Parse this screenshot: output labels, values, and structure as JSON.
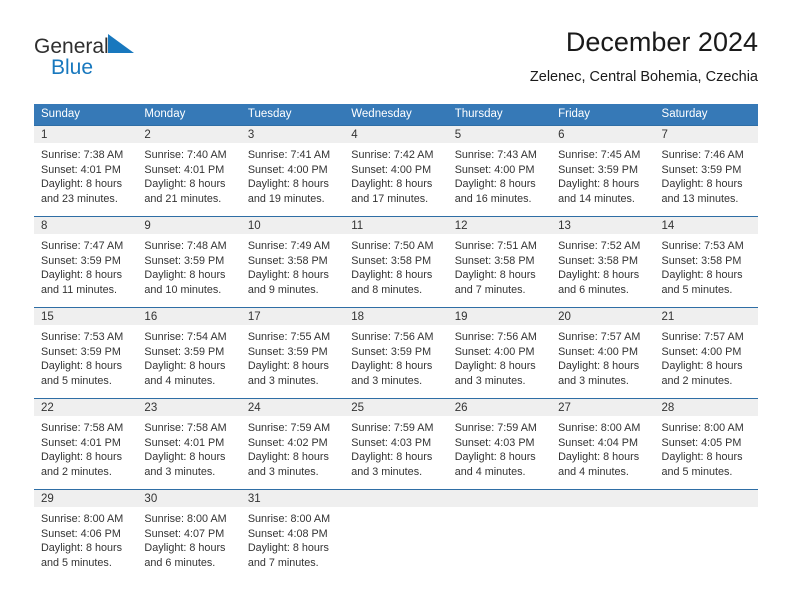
{
  "brand": {
    "name_part1": "General",
    "name_part2": "Blue",
    "color_dark": "#2f2f2f",
    "color_blue": "#1878be"
  },
  "header": {
    "title": "December 2024",
    "subtitle": "Zelenec, Central Bohemia, Czechia"
  },
  "theme": {
    "header_row_bg": "#3679b7",
    "row_divider": "#2f6ea5",
    "daynum_bg": "#efefef",
    "text": "#333333"
  },
  "calendar": {
    "weekday_headers": [
      "Sunday",
      "Monday",
      "Tuesday",
      "Wednesday",
      "Thursday",
      "Friday",
      "Saturday"
    ],
    "weeks": [
      [
        {
          "day": "1",
          "sunrise": "Sunrise: 7:38 AM",
          "sunset": "Sunset: 4:01 PM",
          "daylight_line1": "Daylight: 8 hours",
          "daylight_line2": "and 23 minutes."
        },
        {
          "day": "2",
          "sunrise": "Sunrise: 7:40 AM",
          "sunset": "Sunset: 4:01 PM",
          "daylight_line1": "Daylight: 8 hours",
          "daylight_line2": "and 21 minutes."
        },
        {
          "day": "3",
          "sunrise": "Sunrise: 7:41 AM",
          "sunset": "Sunset: 4:00 PM",
          "daylight_line1": "Daylight: 8 hours",
          "daylight_line2": "and 19 minutes."
        },
        {
          "day": "4",
          "sunrise": "Sunrise: 7:42 AM",
          "sunset": "Sunset: 4:00 PM",
          "daylight_line1": "Daylight: 8 hours",
          "daylight_line2": "and 17 minutes."
        },
        {
          "day": "5",
          "sunrise": "Sunrise: 7:43 AM",
          "sunset": "Sunset: 4:00 PM",
          "daylight_line1": "Daylight: 8 hours",
          "daylight_line2": "and 16 minutes."
        },
        {
          "day": "6",
          "sunrise": "Sunrise: 7:45 AM",
          "sunset": "Sunset: 3:59 PM",
          "daylight_line1": "Daylight: 8 hours",
          "daylight_line2": "and 14 minutes."
        },
        {
          "day": "7",
          "sunrise": "Sunrise: 7:46 AM",
          "sunset": "Sunset: 3:59 PM",
          "daylight_line1": "Daylight: 8 hours",
          "daylight_line2": "and 13 minutes."
        }
      ],
      [
        {
          "day": "8",
          "sunrise": "Sunrise: 7:47 AM",
          "sunset": "Sunset: 3:59 PM",
          "daylight_line1": "Daylight: 8 hours",
          "daylight_line2": "and 11 minutes."
        },
        {
          "day": "9",
          "sunrise": "Sunrise: 7:48 AM",
          "sunset": "Sunset: 3:59 PM",
          "daylight_line1": "Daylight: 8 hours",
          "daylight_line2": "and 10 minutes."
        },
        {
          "day": "10",
          "sunrise": "Sunrise: 7:49 AM",
          "sunset": "Sunset: 3:58 PM",
          "daylight_line1": "Daylight: 8 hours",
          "daylight_line2": "and 9 minutes."
        },
        {
          "day": "11",
          "sunrise": "Sunrise: 7:50 AM",
          "sunset": "Sunset: 3:58 PM",
          "daylight_line1": "Daylight: 8 hours",
          "daylight_line2": "and 8 minutes."
        },
        {
          "day": "12",
          "sunrise": "Sunrise: 7:51 AM",
          "sunset": "Sunset: 3:58 PM",
          "daylight_line1": "Daylight: 8 hours",
          "daylight_line2": "and 7 minutes."
        },
        {
          "day": "13",
          "sunrise": "Sunrise: 7:52 AM",
          "sunset": "Sunset: 3:58 PM",
          "daylight_line1": "Daylight: 8 hours",
          "daylight_line2": "and 6 minutes."
        },
        {
          "day": "14",
          "sunrise": "Sunrise: 7:53 AM",
          "sunset": "Sunset: 3:58 PM",
          "daylight_line1": "Daylight: 8 hours",
          "daylight_line2": "and 5 minutes."
        }
      ],
      [
        {
          "day": "15",
          "sunrise": "Sunrise: 7:53 AM",
          "sunset": "Sunset: 3:59 PM",
          "daylight_line1": "Daylight: 8 hours",
          "daylight_line2": "and 5 minutes."
        },
        {
          "day": "16",
          "sunrise": "Sunrise: 7:54 AM",
          "sunset": "Sunset: 3:59 PM",
          "daylight_line1": "Daylight: 8 hours",
          "daylight_line2": "and 4 minutes."
        },
        {
          "day": "17",
          "sunrise": "Sunrise: 7:55 AM",
          "sunset": "Sunset: 3:59 PM",
          "daylight_line1": "Daylight: 8 hours",
          "daylight_line2": "and 3 minutes."
        },
        {
          "day": "18",
          "sunrise": "Sunrise: 7:56 AM",
          "sunset": "Sunset: 3:59 PM",
          "daylight_line1": "Daylight: 8 hours",
          "daylight_line2": "and 3 minutes."
        },
        {
          "day": "19",
          "sunrise": "Sunrise: 7:56 AM",
          "sunset": "Sunset: 4:00 PM",
          "daylight_line1": "Daylight: 8 hours",
          "daylight_line2": "and 3 minutes."
        },
        {
          "day": "20",
          "sunrise": "Sunrise: 7:57 AM",
          "sunset": "Sunset: 4:00 PM",
          "daylight_line1": "Daylight: 8 hours",
          "daylight_line2": "and 3 minutes."
        },
        {
          "day": "21",
          "sunrise": "Sunrise: 7:57 AM",
          "sunset": "Sunset: 4:00 PM",
          "daylight_line1": "Daylight: 8 hours",
          "daylight_line2": "and 2 minutes."
        }
      ],
      [
        {
          "day": "22",
          "sunrise": "Sunrise: 7:58 AM",
          "sunset": "Sunset: 4:01 PM",
          "daylight_line1": "Daylight: 8 hours",
          "daylight_line2": "and 2 minutes."
        },
        {
          "day": "23",
          "sunrise": "Sunrise: 7:58 AM",
          "sunset": "Sunset: 4:01 PM",
          "daylight_line1": "Daylight: 8 hours",
          "daylight_line2": "and 3 minutes."
        },
        {
          "day": "24",
          "sunrise": "Sunrise: 7:59 AM",
          "sunset": "Sunset: 4:02 PM",
          "daylight_line1": "Daylight: 8 hours",
          "daylight_line2": "and 3 minutes."
        },
        {
          "day": "25",
          "sunrise": "Sunrise: 7:59 AM",
          "sunset": "Sunset: 4:03 PM",
          "daylight_line1": "Daylight: 8 hours",
          "daylight_line2": "and 3 minutes."
        },
        {
          "day": "26",
          "sunrise": "Sunrise: 7:59 AM",
          "sunset": "Sunset: 4:03 PM",
          "daylight_line1": "Daylight: 8 hours",
          "daylight_line2": "and 4 minutes."
        },
        {
          "day": "27",
          "sunrise": "Sunrise: 8:00 AM",
          "sunset": "Sunset: 4:04 PM",
          "daylight_line1": "Daylight: 8 hours",
          "daylight_line2": "and 4 minutes."
        },
        {
          "day": "28",
          "sunrise": "Sunrise: 8:00 AM",
          "sunset": "Sunset: 4:05 PM",
          "daylight_line1": "Daylight: 8 hours",
          "daylight_line2": "and 5 minutes."
        }
      ],
      [
        {
          "day": "29",
          "sunrise": "Sunrise: 8:00 AM",
          "sunset": "Sunset: 4:06 PM",
          "daylight_line1": "Daylight: 8 hours",
          "daylight_line2": "and 5 minutes."
        },
        {
          "day": "30",
          "sunrise": "Sunrise: 8:00 AM",
          "sunset": "Sunset: 4:07 PM",
          "daylight_line1": "Daylight: 8 hours",
          "daylight_line2": "and 6 minutes."
        },
        {
          "day": "31",
          "sunrise": "Sunrise: 8:00 AM",
          "sunset": "Sunset: 4:08 PM",
          "daylight_line1": "Daylight: 8 hours",
          "daylight_line2": "and 7 minutes."
        },
        {
          "day": "",
          "sunrise": "",
          "sunset": "",
          "daylight_line1": "",
          "daylight_line2": ""
        },
        {
          "day": "",
          "sunrise": "",
          "sunset": "",
          "daylight_line1": "",
          "daylight_line2": ""
        },
        {
          "day": "",
          "sunrise": "",
          "sunset": "",
          "daylight_line1": "",
          "daylight_line2": ""
        },
        {
          "day": "",
          "sunrise": "",
          "sunset": "",
          "daylight_line1": "",
          "daylight_line2": ""
        }
      ]
    ]
  }
}
